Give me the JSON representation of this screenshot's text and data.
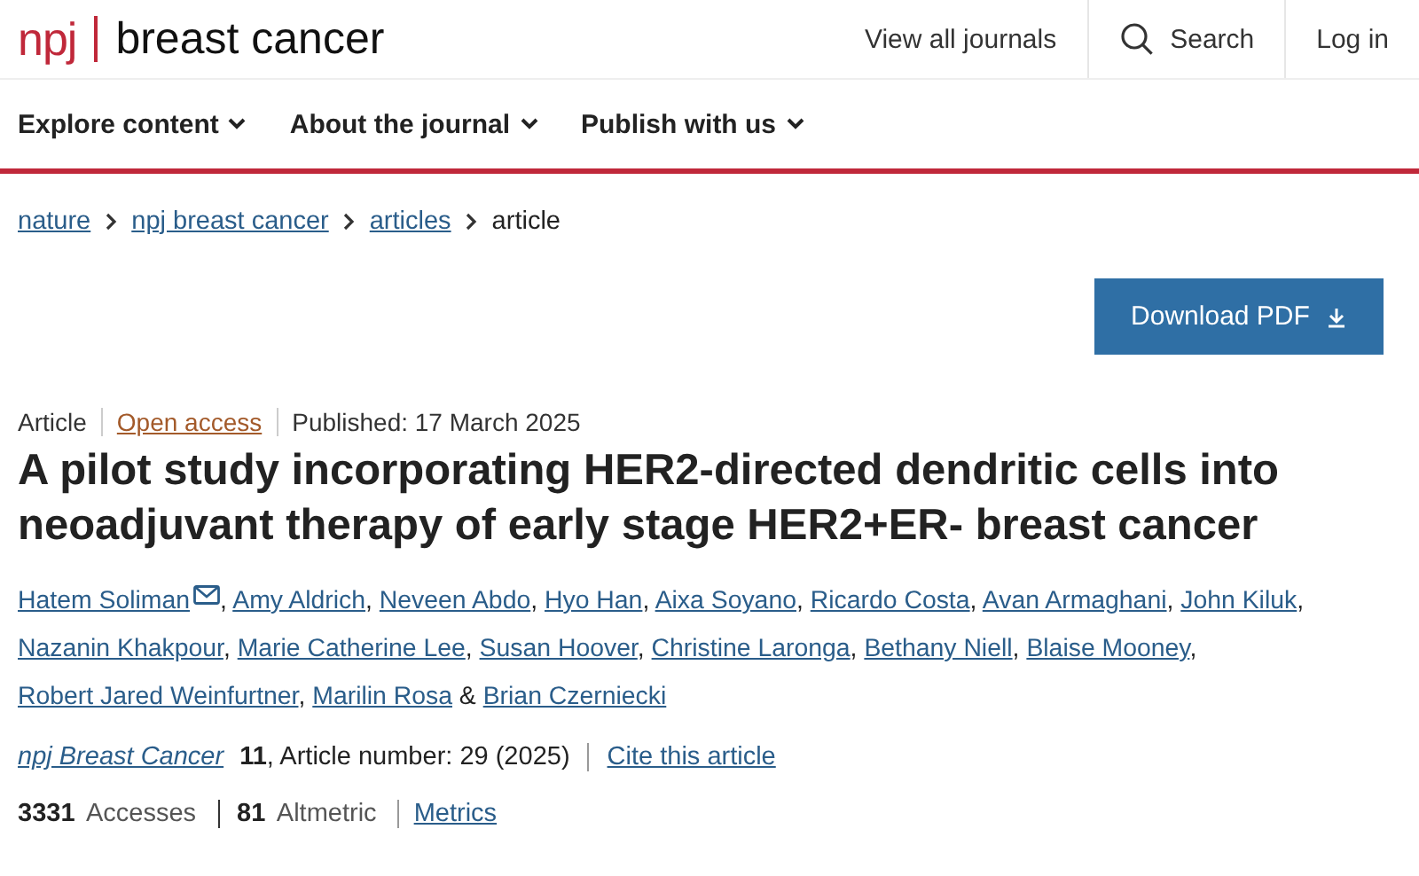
{
  "header": {
    "logo": "npj",
    "journal": "breast cancer",
    "links": [
      {
        "label": "View all journals",
        "kind": "text"
      },
      {
        "label": "Search",
        "kind": "search"
      },
      {
        "label": "Log in",
        "kind": "text"
      }
    ]
  },
  "nav": [
    {
      "label": "Explore content"
    },
    {
      "label": "About the journal"
    },
    {
      "label": "Publish with us"
    }
  ],
  "breadcrumb": [
    {
      "label": "nature",
      "link": true
    },
    {
      "label": "npj breast cancer",
      "link": true
    },
    {
      "label": "articles",
      "link": true
    },
    {
      "label": "article",
      "link": false
    }
  ],
  "download_button": "Download PDF",
  "meta": [
    {
      "label": "Article",
      "kind": "text"
    },
    {
      "label": "Open access",
      "kind": "access"
    },
    {
      "label": "Published: 17 March 2025",
      "kind": "text"
    }
  ],
  "title": "A pilot study incorporating HER2-directed dendritic cells into neoadjuvant therapy of early stage HER2+ER- breast cancer",
  "authors": [
    {
      "name": "Hatem Soliman",
      "email": true,
      "after": ","
    },
    {
      "name": "Amy Aldrich",
      "email": false,
      "after": ","
    },
    {
      "name": "Neveen Abdo",
      "email": false,
      "after": ","
    },
    {
      "name": "Hyo Han",
      "email": false,
      "after": ","
    },
    {
      "name": "Aixa Soyano",
      "email": false,
      "after": ","
    },
    {
      "name": "Ricardo Costa",
      "email": false,
      "after": ","
    },
    {
      "name": "Avan Armaghani",
      "email": false,
      "after": ","
    },
    {
      "name": "John Kiluk",
      "email": false,
      "after": ","
    },
    {
      "name": "Nazanin Khakpour",
      "email": false,
      "after": ","
    },
    {
      "name": "Marie Catherine Lee",
      "email": false,
      "after": ","
    },
    {
      "name": "Susan Hoover",
      "email": false,
      "after": ","
    },
    {
      "name": "Christine Laronga",
      "email": false,
      "after": ","
    },
    {
      "name": "Bethany Niell",
      "email": false,
      "after": ","
    },
    {
      "name": "Blaise Mooney",
      "email": false,
      "after": ","
    },
    {
      "name": "Robert Jared Weinfurtner",
      "email": false,
      "after": ","
    },
    {
      "name": "Marilin Rosa",
      "email": false,
      "after": "&"
    },
    {
      "name": "Brian Czerniecki",
      "email": false
    }
  ],
  "citation": {
    "journal": "npj Breast Cancer",
    "volume": "11",
    "details": ", Article number: 29 (2025)",
    "cite_link": "Cite this article"
  },
  "metrics": {
    "items": [
      "**3331** Accesses",
      "**81** Altmetric"
    ],
    "link": "Metrics"
  }
}
